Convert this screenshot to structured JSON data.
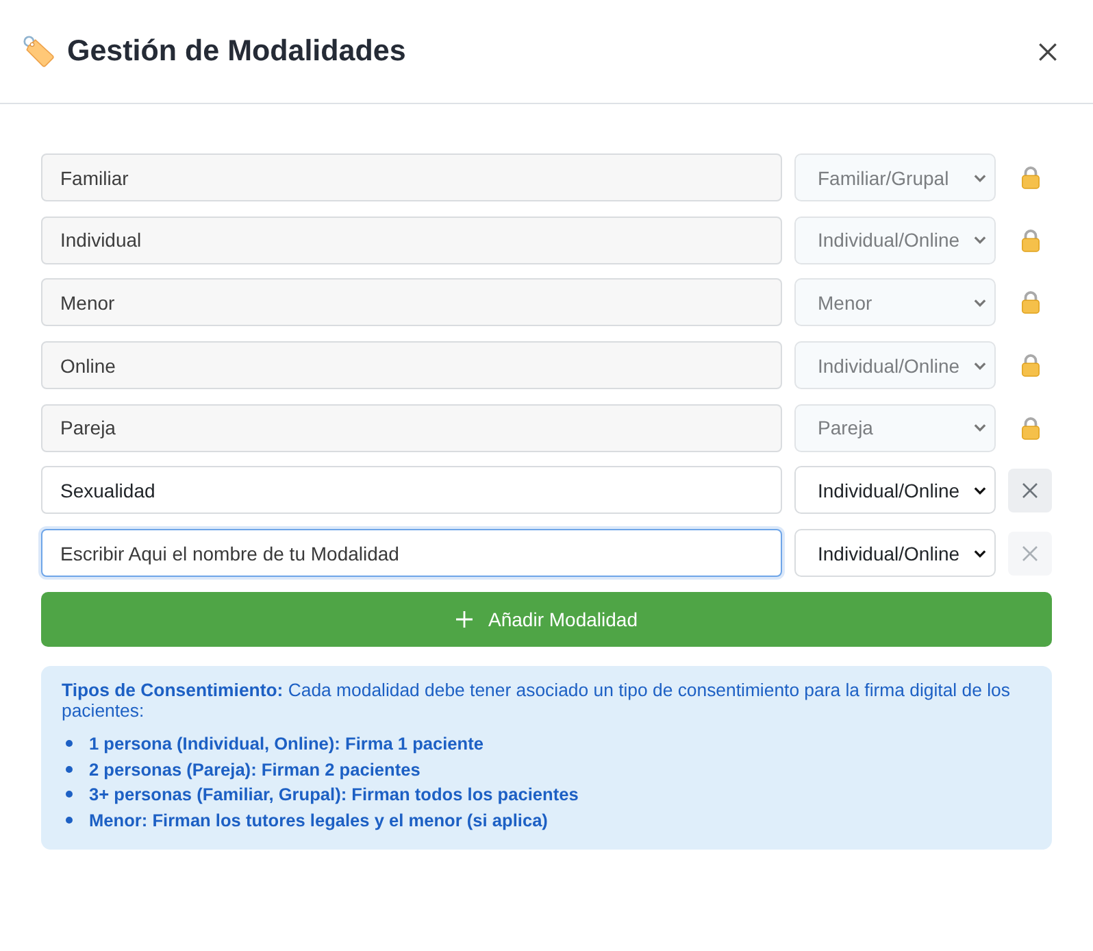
{
  "header": {
    "title": "Gestión de Modalidades"
  },
  "modalidades": [
    {
      "kind": "locked",
      "name": "Familiar",
      "consent": "Familiar/Grupal"
    },
    {
      "kind": "locked",
      "name": "Individual",
      "consent": "Individual/Online"
    },
    {
      "kind": "locked",
      "name": "Menor",
      "consent": "Menor"
    },
    {
      "kind": "locked",
      "name": "Online",
      "consent": "Individual/Online"
    },
    {
      "kind": "locked",
      "name": "Pareja",
      "consent": "Pareja"
    },
    {
      "kind": "editable",
      "name": "Sexualidad",
      "consent": "Individual/Online",
      "focused": false,
      "delete_disabled": false
    },
    {
      "kind": "editable",
      "name": "Escribir Aqui el nombre de tu Modalidad",
      "consent": "Individual/Online",
      "focused": true,
      "delete_disabled": true
    }
  ],
  "add_button": {
    "label": "Añadir Modalidad"
  },
  "info": {
    "text": "**Tipos de Consentimiento:** Cada modalidad debe tener asociado un tipo de consentimiento para la firma digital de los pacientes:",
    "items": [
      "1 persona (Individual, Online): Firma 1 paciente",
      "2 personas (Pareja): Firman 2 pacientes",
      "3+ personas (Familiar, Grupal): Firman todos los pacientes",
      "Menor: Firman los tutores legales y el menor (si aplica)"
    ]
  }
}
